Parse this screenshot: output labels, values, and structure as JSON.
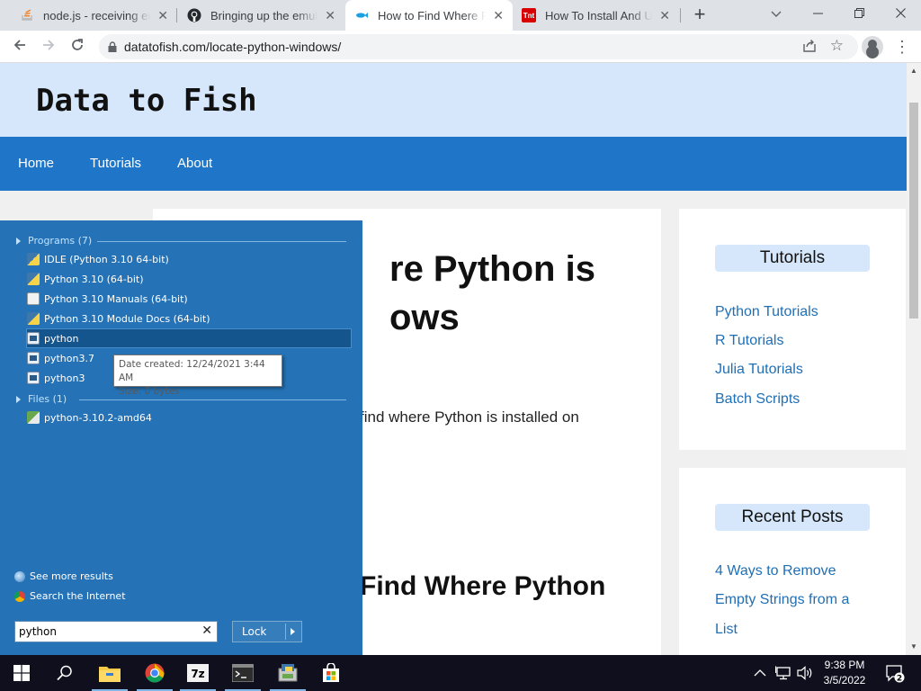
{
  "browser": {
    "tabs": [
      {
        "title": "node.js - receiving erro",
        "icon": "stackoverflow-icon",
        "active": false
      },
      {
        "title": "Bringing up the emulat",
        "icon": "github-icon",
        "active": false
      },
      {
        "title": "How to Find Where Pyt",
        "icon": "fish-icon",
        "active": true
      },
      {
        "title": "How To Install And Use",
        "icon": "tnt-icon",
        "active": false
      }
    ],
    "url": "datatofish.com/locate-python-windows/",
    "colors": {
      "tabbar": "#dee1e6",
      "active_tab": "#ffffff"
    }
  },
  "site": {
    "title": "Data to Fish",
    "nav": [
      "Home",
      "Tutorials",
      "About"
    ],
    "colors": {
      "header": "#d7e7fb",
      "nav": "#1f75c8",
      "link": "#1f6fb5"
    },
    "article": {
      "title_visible": "re Python is\nows",
      "intro_visible": "find where Python is installed on",
      "h2_visible": "Find Where Python"
    },
    "sidebar": {
      "tutorials_heading": "Tutorials",
      "tutorials": [
        "Python Tutorials",
        "R Tutorials",
        "Julia Tutorials",
        "Batch Scripts"
      ],
      "recent_heading": "Recent Posts",
      "recent": [
        "4 Ways to Remove",
        "Empty Strings from a",
        "List"
      ]
    }
  },
  "start_menu": {
    "programs_header": "Programs (7)",
    "programs": [
      {
        "label": "IDLE (Python 3.10 64-bit)",
        "icon": "python-icon"
      },
      {
        "label": "Python 3.10 (64-bit)",
        "icon": "python-icon"
      },
      {
        "label": "Python 3.10 Manuals (64-bit)",
        "icon": "help-doc-icon"
      },
      {
        "label": "Python 3.10 Module Docs (64-bit)",
        "icon": "python-icon"
      },
      {
        "label": "python",
        "icon": "exe-icon",
        "selected": true
      },
      {
        "label": "python3.7",
        "icon": "exe-icon"
      },
      {
        "label": "python3",
        "icon": "exe-icon"
      }
    ],
    "tooltip": {
      "line1": "Date created: 12/24/2021 3:44 AM",
      "line2": "Size: 0 bytes"
    },
    "files_header": "Files (1)",
    "files": [
      {
        "label": "python-3.10.2-amd64",
        "icon": "installer-icon"
      }
    ],
    "see_more": "See more results",
    "search_internet": "Search the Internet",
    "search_value": "python",
    "lock_label": "Lock",
    "color": "#1e6eb4"
  },
  "taskbar": {
    "apps": [
      "start-icon",
      "search-icon",
      "file-explorer-icon",
      "chrome-icon",
      "7zip-icon",
      "terminal-icon",
      "python-installer-icon",
      "store-icon"
    ],
    "time": "9:38 PM",
    "date": "3/5/2022",
    "notification_count": "2"
  }
}
